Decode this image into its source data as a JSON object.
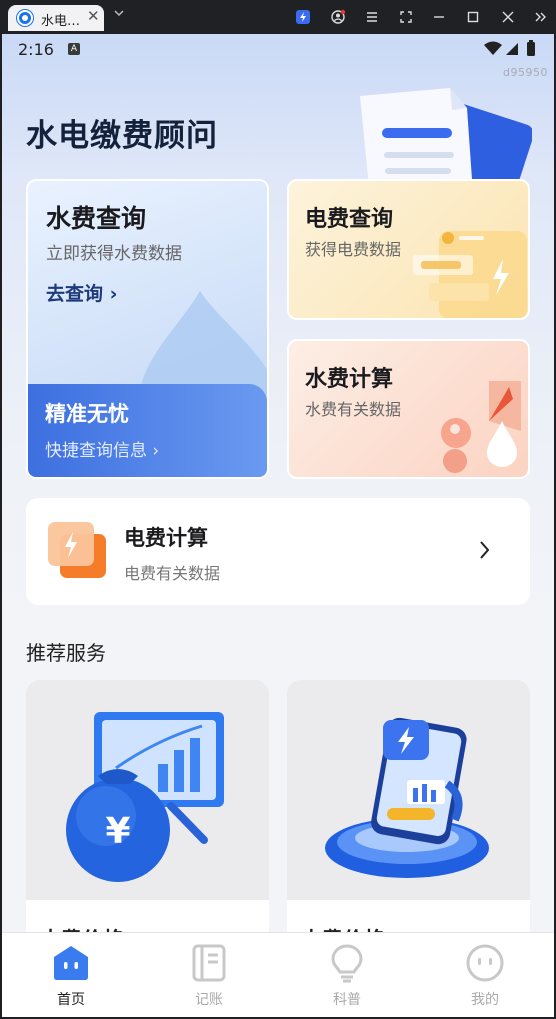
{
  "browser": {
    "tab_title": "水电…",
    "tab_close": "✕"
  },
  "status_bar": {
    "time": "2:16",
    "indicator": "A"
  },
  "watermark": "d95950",
  "page_title": "水电缴费顾问",
  "cards": {
    "water_query": {
      "title": "水费查询",
      "subtitle": "立即获得水费数据",
      "link": "去查询 ›"
    },
    "accurate": {
      "title": "精准无忧",
      "subtitle": "快捷查询信息 ›"
    },
    "electric_query": {
      "title": "电费查询",
      "subtitle": "获得电费数据"
    },
    "water_calc": {
      "title": "水费计算",
      "subtitle": "水费有关数据"
    },
    "electric_calc": {
      "title": "电费计算",
      "subtitle": "电费有关数据"
    }
  },
  "section_title": "推荐服务",
  "services": [
    {
      "title": "水费价格"
    },
    {
      "title": "电费价格"
    }
  ],
  "nav": [
    {
      "label": "首页",
      "icon": "home-face-icon",
      "active": true
    },
    {
      "label": "记账",
      "icon": "notebook-icon",
      "active": false
    },
    {
      "label": "科普",
      "icon": "lightbulb-icon",
      "active": false
    },
    {
      "label": "我的",
      "icon": "profile-face-icon",
      "active": false
    }
  ],
  "colors": {
    "accent": "#3d6fe0",
    "primary_text": "#14213a",
    "nav_active": "#3a7cf0"
  }
}
